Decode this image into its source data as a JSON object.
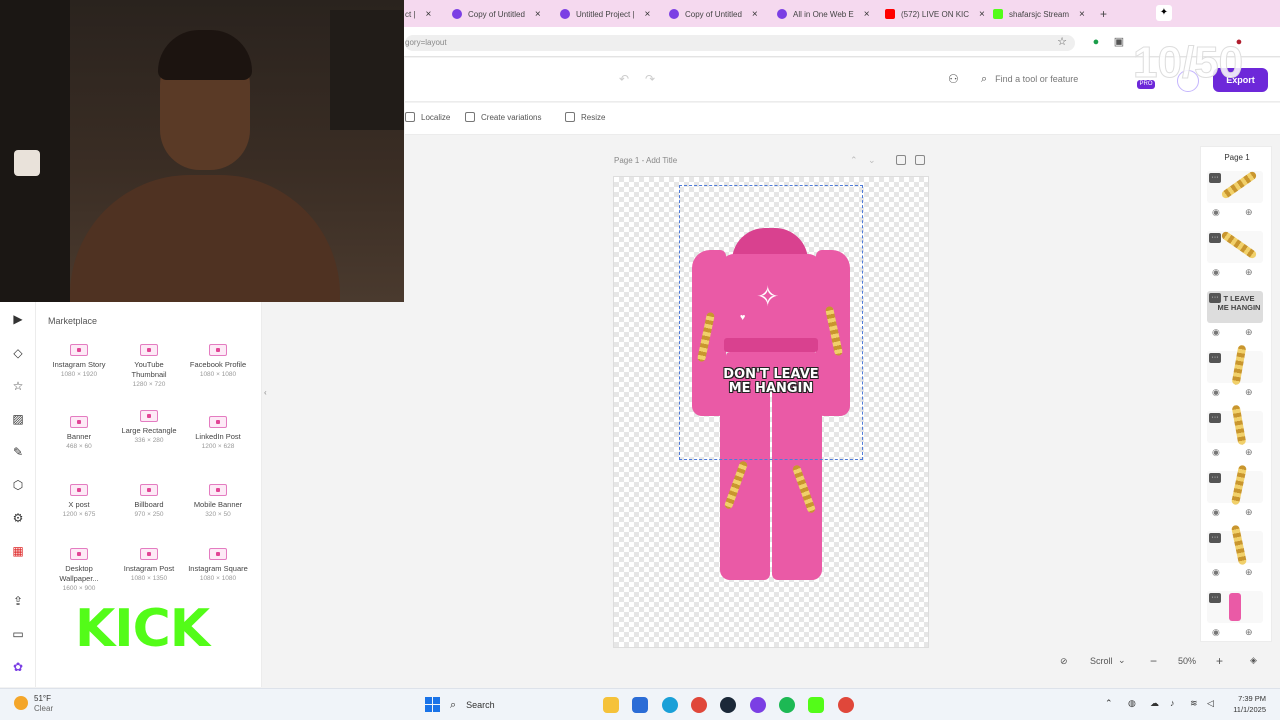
{
  "browser": {
    "tabs": [
      {
        "label": "ct |",
        "color": "#e44aa4"
      },
      {
        "label": "Copy of Untitled",
        "color": "#7b3fe4"
      },
      {
        "label": "Untitled Project |",
        "color": "#7b3fe4"
      },
      {
        "label": "Copy of Untitled",
        "color": "#7b3fe4"
      },
      {
        "label": "All in One Web E",
        "color": "#7b3fe4"
      },
      {
        "label": "(572) LIVE ON KIC",
        "color": "#ff0000"
      },
      {
        "label": "shafarsjc Stream",
        "color": "#53fc18"
      }
    ],
    "new_tab": "+",
    "url": "gory=layout"
  },
  "header": {
    "search_placeholder": "Find a tool or feature",
    "pro_badge": "PRO",
    "export_label": "Export",
    "overlay_counter": "10/50"
  },
  "toolbar": {
    "localize": "Localize",
    "create_variations": "Create variations",
    "resize": "Resize"
  },
  "canvas": {
    "page_label": "Page 1 - Add Title",
    "graphic_text_line1": "DON'T LEAVE",
    "graphic_text_line2": "ME HANGIN"
  },
  "marketplace": {
    "title": "Marketplace",
    "items": [
      {
        "name": "Instagram Story",
        "dim": "1080 × 1920"
      },
      {
        "name": "YouTube Thumbnail",
        "dim": "1280 × 720"
      },
      {
        "name": "Facebook Profile",
        "dim": "1080 × 1080"
      },
      {
        "name": "Banner",
        "dim": "468 × 60"
      },
      {
        "name": "Large Rectangle",
        "dim": "336 × 280"
      },
      {
        "name": "LinkedIn Post",
        "dim": "1200 × 628"
      },
      {
        "name": "X post",
        "dim": "1200 × 675"
      },
      {
        "name": "Billboard",
        "dim": "970 × 250"
      },
      {
        "name": "Mobile Banner",
        "dim": "320 × 50"
      },
      {
        "name": "Desktop Wallpaper...",
        "dim": "1600 × 900"
      },
      {
        "name": "Instagram Post",
        "dim": "1080 × 1350"
      },
      {
        "name": "Instagram Square",
        "dim": "1080 × 1080"
      }
    ],
    "kick_logo": "KICK"
  },
  "layers": {
    "title": "Page 1",
    "items": [
      "chain-layer",
      "chain-layer",
      "text-layer",
      "chain-layer",
      "chain-layer",
      "chain-layer",
      "chain-layer",
      "outfit-layer"
    ],
    "text_layer_label": "T LEAVE ME HANGIN"
  },
  "bottom": {
    "scroll_label": "Scroll",
    "zoom": "50%"
  },
  "taskbar": {
    "weather_temp": "51°F",
    "weather_desc": "Clear",
    "search_label": "Search",
    "time": "7:39 PM",
    "date": "11/1/2025"
  }
}
